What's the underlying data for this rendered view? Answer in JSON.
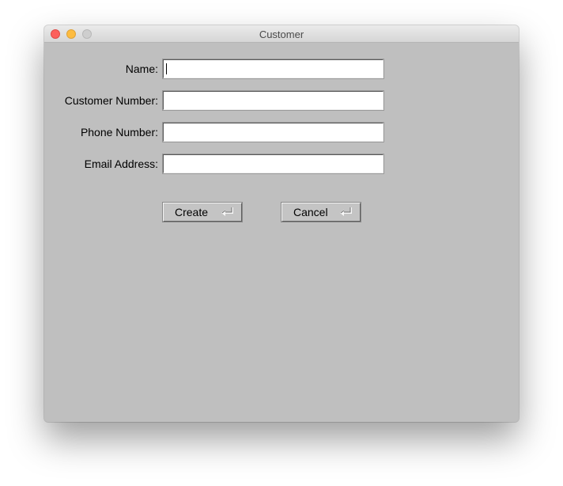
{
  "window": {
    "title": "Customer"
  },
  "form": {
    "fields": [
      {
        "label": "Name:",
        "value": ""
      },
      {
        "label": "Customer Number:",
        "value": ""
      },
      {
        "label": "Phone Number:",
        "value": ""
      },
      {
        "label": "Email Address:",
        "value": ""
      }
    ]
  },
  "buttons": {
    "create_label": "Create",
    "cancel_label": "Cancel"
  },
  "icons": {
    "window_controls": [
      "close-icon",
      "minimize-icon",
      "zoom-icon"
    ],
    "button_accessory": "return-key-icon"
  },
  "colors": {
    "window_background": "#bfbfbf",
    "field_background": "#ffffff",
    "close": "#fc605c",
    "minimize": "#fdbc40",
    "zoom_inactive": "#cecece"
  }
}
